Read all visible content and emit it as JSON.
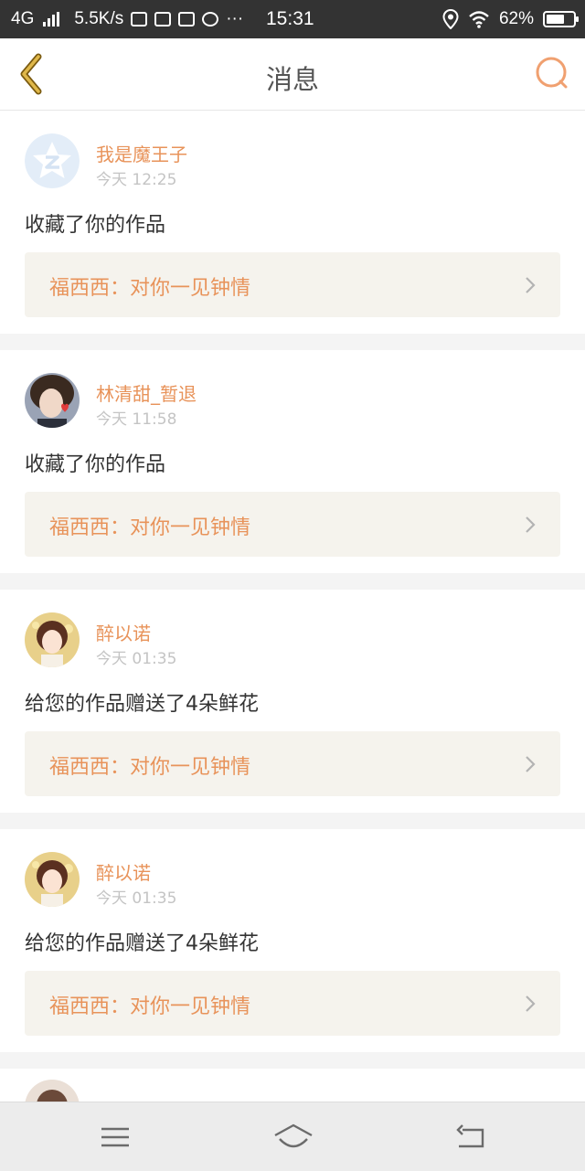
{
  "status_bar": {
    "network": "4G",
    "speed": "5.5K/s",
    "dots": "···",
    "time": "15:31",
    "battery": "62%"
  },
  "header": {
    "title": "消息"
  },
  "messages": [
    {
      "name": "我是魔王子",
      "time": "今天 12:25",
      "action": "收藏了你的作品",
      "work": "福西西：对你一见钟情"
    },
    {
      "name": "林清甜_暂退",
      "time": "今天 11:58",
      "action": "收藏了你的作品",
      "work": "福西西：对你一见钟情"
    },
    {
      "name": "醉以诺",
      "time": "今天 01:35",
      "action": "给您的作品赠送了4朵鲜花",
      "work": "福西西：对你一见钟情"
    },
    {
      "name": "醉以诺",
      "time": "今天 01:35",
      "action": "给您的作品赠送了4朵鲜花",
      "work": "福西西：对你一见钟情"
    }
  ],
  "colors": {
    "accent": "#e8935a",
    "back_icon": "#c79a2a",
    "status_bar": "#333333"
  }
}
